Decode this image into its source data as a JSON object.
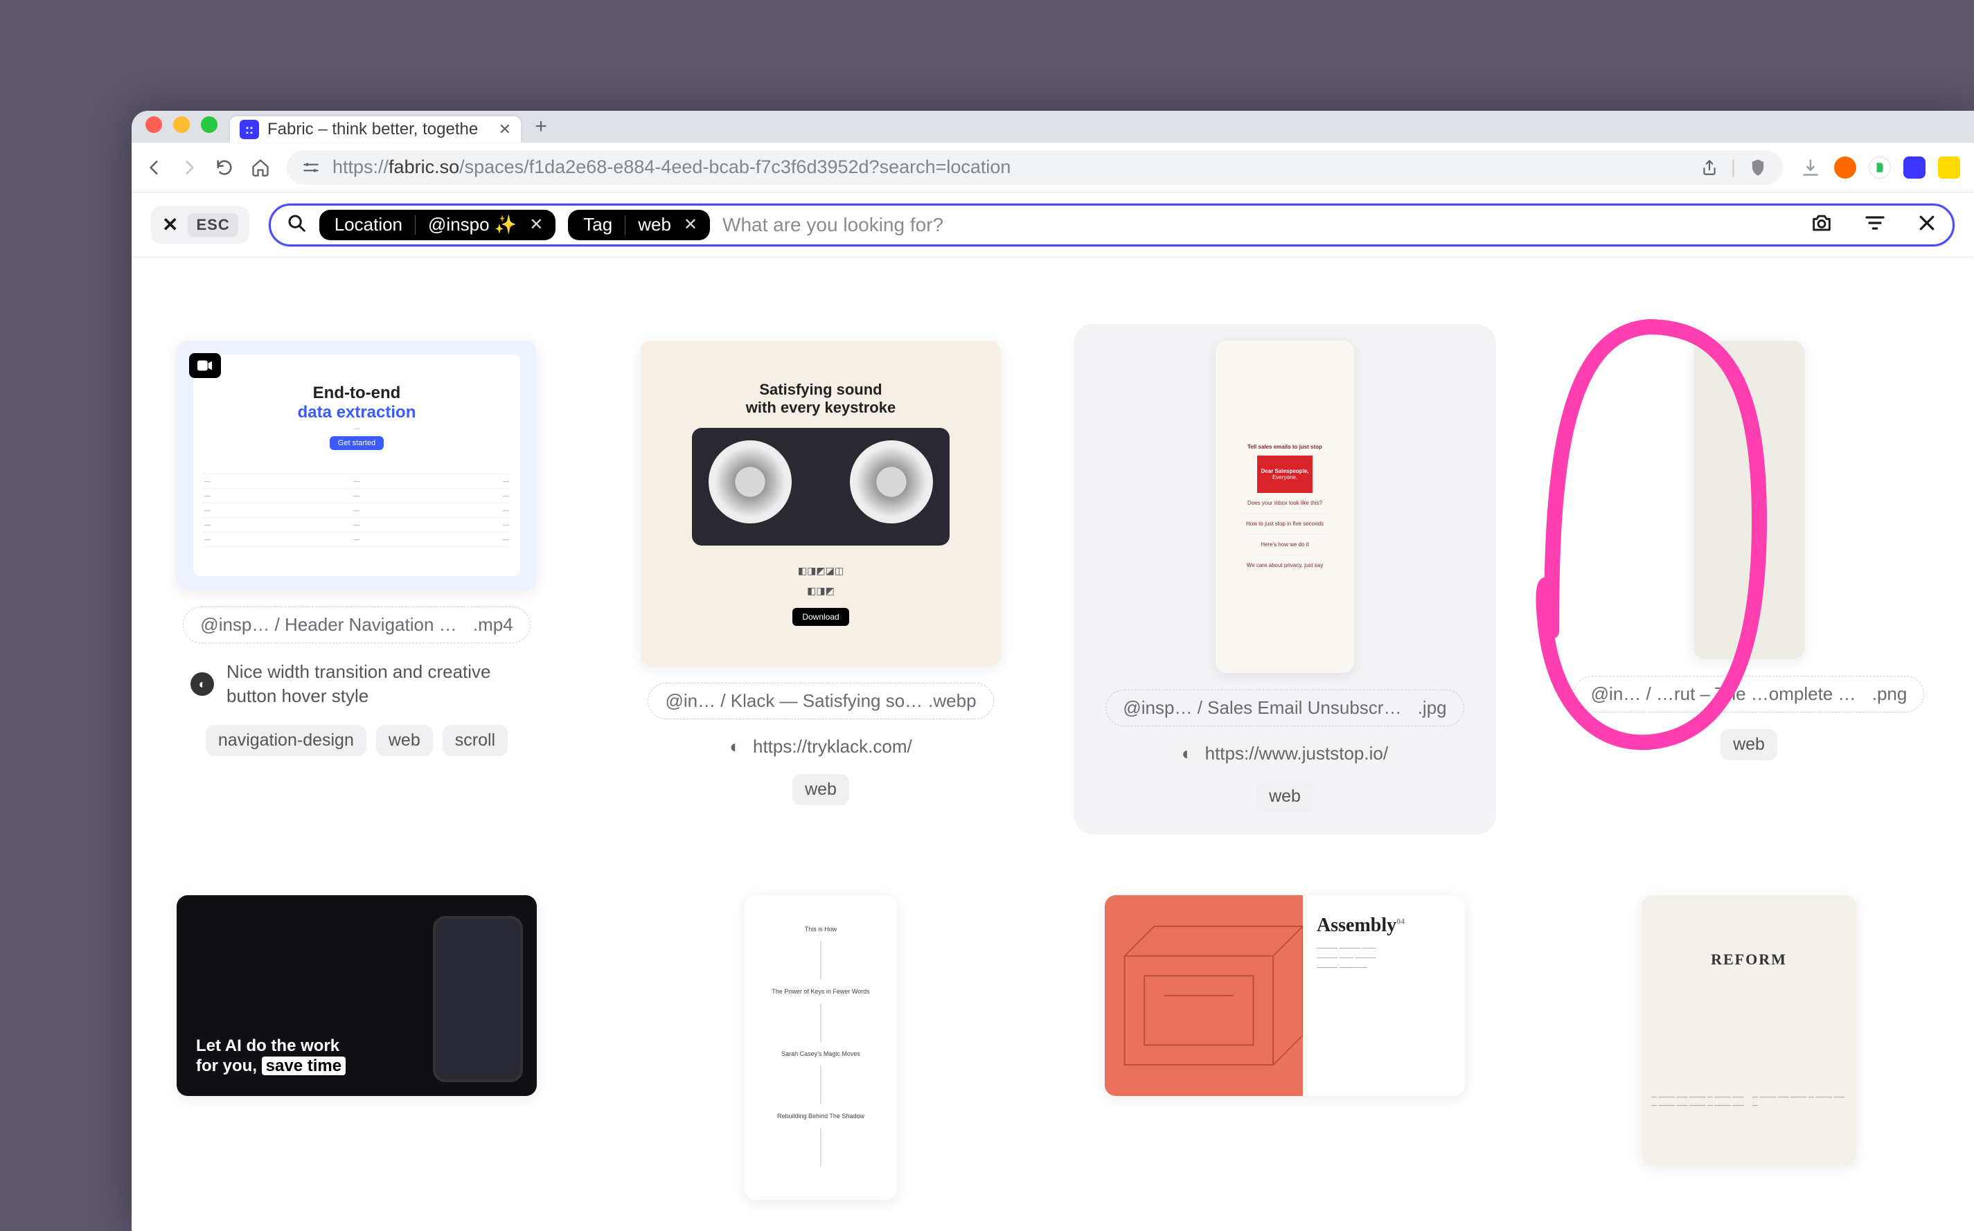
{
  "browser": {
    "tab_title": "Fabric – think better, togethe",
    "url_prefix": "https://",
    "url_host": "fabric.so",
    "url_path": "/spaces/f1da2e68-e884-4eed-bcab-f7c3f6d3952d?search=location"
  },
  "search": {
    "esc_label": "ESC",
    "chips": [
      {
        "k": "Location",
        "v": "@inspo ✨"
      },
      {
        "k": "Tag",
        "v": "web"
      }
    ],
    "placeholder": "What are you looking for?"
  },
  "cards": [
    {
      "kind": "video",
      "breadcrumb": "@insp… / Header Navigation …",
      "ext": ".mp4",
      "desc": "Nice width transition and creative button hover style",
      "tags": [
        "navigation-design",
        "web",
        "scroll"
      ],
      "preview": {
        "line1": "End-to-end",
        "line2": "data extraction"
      }
    },
    {
      "kind": "image",
      "breadcrumb": "@in… / Klack — Satisfying so…",
      "ext": ".webp",
      "link": "https://tryklack.com/",
      "tags": [
        "web"
      ],
      "preview": {
        "line1": "Satisfying sound",
        "line2": "with every keystroke"
      }
    },
    {
      "kind": "image",
      "breadcrumb": "@insp… / Sales Email Unsubscr…",
      "ext": ".jpg",
      "link": "https://www.juststop.io/",
      "tags": [
        "web"
      ],
      "selected": true,
      "preview": {
        "line1": "Tell sales emails to just stop",
        "line2": "Dear Salespeople,"
      }
    },
    {
      "kind": "image",
      "breadcrumb": "@in… / …rut – The …omplete …",
      "ext": ".png",
      "tags": [
        "web"
      ],
      "annotated": true
    },
    {
      "kind": "image",
      "preview": {
        "line1": "Let AI do the work",
        "line2": "for you, save time"
      }
    },
    {
      "kind": "image"
    },
    {
      "kind": "image",
      "preview": {
        "line1": "Assembly",
        "sup": "04"
      }
    },
    {
      "kind": "image",
      "preview": {
        "line1": "REFORM"
      }
    }
  ]
}
